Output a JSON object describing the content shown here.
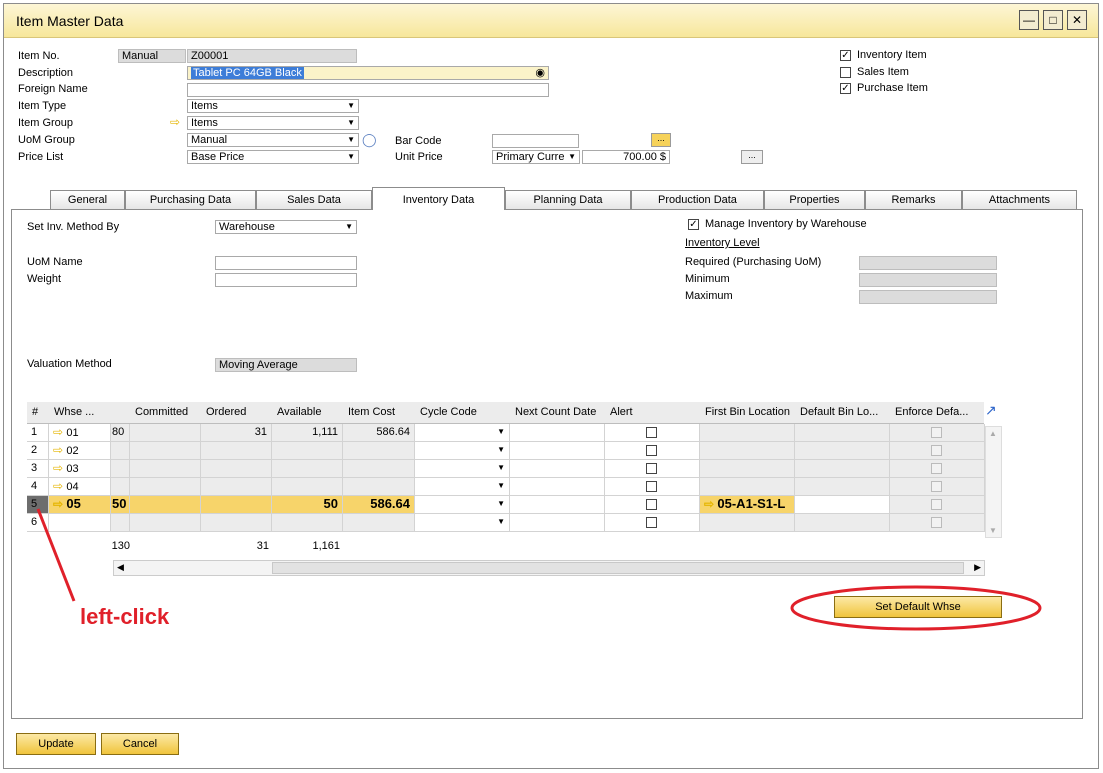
{
  "window": {
    "title": "Item Master Data"
  },
  "header": {
    "item_no_label": "Item No.",
    "item_no_series": "Manual",
    "item_no_value": "Z00001",
    "description_label": "Description",
    "description_value": "Tablet PC 64GB Black",
    "foreign_name_label": "Foreign Name",
    "item_type_label": "Item Type",
    "item_type_value": "Items",
    "item_group_label": "Item Group",
    "item_group_value": "Items",
    "uom_group_label": "UoM Group",
    "uom_group_value": "Manual",
    "price_list_label": "Price List",
    "price_list_value": "Base Price",
    "bar_code_label": "Bar Code",
    "unit_price_label": "Unit Price",
    "unit_price_currency": "Primary Curre",
    "unit_price_value": "700.00 $",
    "ellipsis": "..."
  },
  "flags": {
    "inventory_item": "Inventory Item",
    "sales_item": "Sales Item",
    "purchase_item": "Purchase Item"
  },
  "tabs": [
    "General",
    "Purchasing Data",
    "Sales Data",
    "Inventory Data",
    "Planning Data",
    "Production Data",
    "Properties",
    "Remarks",
    "Attachments"
  ],
  "inventory": {
    "set_inv_method_label": "Set Inv. Method By",
    "set_inv_method_value": "Warehouse",
    "manage_by_whse": "Manage Inventory by Warehouse",
    "inventory_level": "Inventory Level",
    "required_label": "Required (Purchasing UoM)",
    "minimum_label": "Minimum",
    "maximum_label": "Maximum",
    "uom_name_label": "UoM Name",
    "weight_label": "Weight",
    "valuation_label": "Valuation Method",
    "valuation_value": "Moving Average"
  },
  "grid": {
    "headers": [
      "#",
      "Whse ...",
      "",
      "Committed",
      "Ordered",
      "Available",
      "Item Cost",
      "Cycle Code",
      "Next Count Date",
      "Alert",
      "First Bin Location",
      "Default Bin Lo...",
      "Enforce Defa..."
    ],
    "rows": [
      {
        "num": "1",
        "whse": "01",
        "instock": "80",
        "ordered": "31",
        "available": "1,111",
        "cost": "586.64",
        "bin": ""
      },
      {
        "num": "2",
        "whse": "02",
        "instock": "",
        "ordered": "",
        "available": "",
        "cost": "",
        "bin": ""
      },
      {
        "num": "3",
        "whse": "03",
        "instock": "",
        "ordered": "",
        "available": "",
        "cost": "",
        "bin": ""
      },
      {
        "num": "4",
        "whse": "04",
        "instock": "",
        "ordered": "",
        "available": "",
        "cost": "",
        "bin": ""
      },
      {
        "num": "5",
        "whse": "05",
        "instock": "50",
        "ordered": "",
        "available": "50",
        "cost": "586.64",
        "bin": "05-A1-S1-L"
      },
      {
        "num": "6",
        "whse": "",
        "instock": "",
        "ordered": "",
        "available": "",
        "cost": "",
        "bin": ""
      }
    ],
    "totals": {
      "instock": "130",
      "ordered": "31",
      "available": "1,161"
    }
  },
  "buttons": {
    "set_default": "Set Default Whse",
    "update": "Update",
    "cancel": "Cancel"
  },
  "annotation": {
    "text": "left-click",
    "color": "#e0202a"
  },
  "colors": {
    "accent": "#f7e79b",
    "highlight": "#f7d46a"
  }
}
